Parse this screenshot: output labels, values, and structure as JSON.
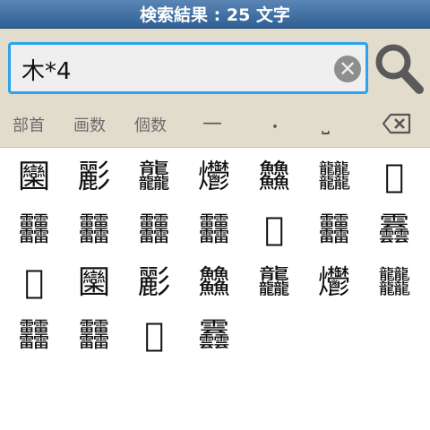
{
  "header": {
    "title": "検索結果 : 25 文字"
  },
  "search": {
    "value": "木*4"
  },
  "toolbar": {
    "radical_label": "部首",
    "strokes_label": "画数",
    "count_label": "個数",
    "dash_symbol": "—",
    "dot_symbol": "・",
    "space_symbol": "⎵",
    "backspace_icon": "backspace-icon"
  },
  "results": [
    "圞",
    "彲",
    "龘",
    "爩",
    "䲜",
    "𪚥",
    "𠁢",
    "䨻",
    "䨻",
    "䨻",
    "䨻",
    "𪛉",
    "䨻",
    "䨺",
    "𠁢",
    "圞",
    "彲",
    "䲜",
    "龘",
    "爩",
    "𪚥",
    "䨻",
    "䨻",
    "𪛉",
    "䨺"
  ],
  "colors": {
    "title_bar": "#3b6ea5",
    "search_border": "#2da3ee",
    "toolbar_bg": "#e2dccc"
  }
}
